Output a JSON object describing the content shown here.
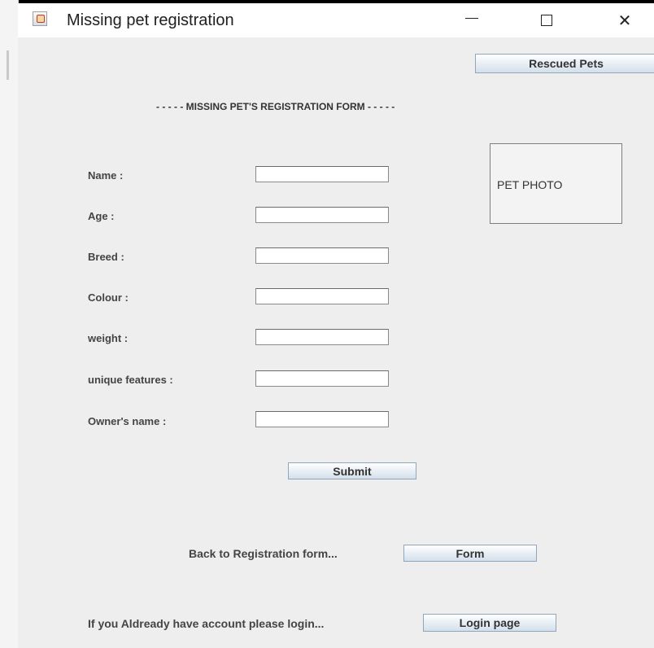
{
  "window": {
    "title": "Missing pet registration",
    "controls": {
      "minimize": "—",
      "maximize": "☐",
      "close": "✕"
    }
  },
  "toolbar": {
    "rescued_pets_label": "Rescued Pets"
  },
  "form": {
    "heading": "- - - - - MISSING PET'S REGISTRATION FORM - - - - -",
    "fields": [
      {
        "label": "Name :",
        "value": ""
      },
      {
        "label": "Age :",
        "value": ""
      },
      {
        "label": "Breed :",
        "value": ""
      },
      {
        "label": "Colour :",
        "value": ""
      },
      {
        "label": "weight :",
        "value": ""
      },
      {
        "label": "unique features :",
        "value": ""
      },
      {
        "label": "Owner's name :",
        "value": ""
      }
    ],
    "photo_placeholder": "PET PHOTO",
    "submit_label": "Submit"
  },
  "footer": {
    "back_text": "Back to Registration form...",
    "form_button_label": "Form",
    "login_text": "If you Aldready have account please login...",
    "login_button_label": "Login page"
  }
}
